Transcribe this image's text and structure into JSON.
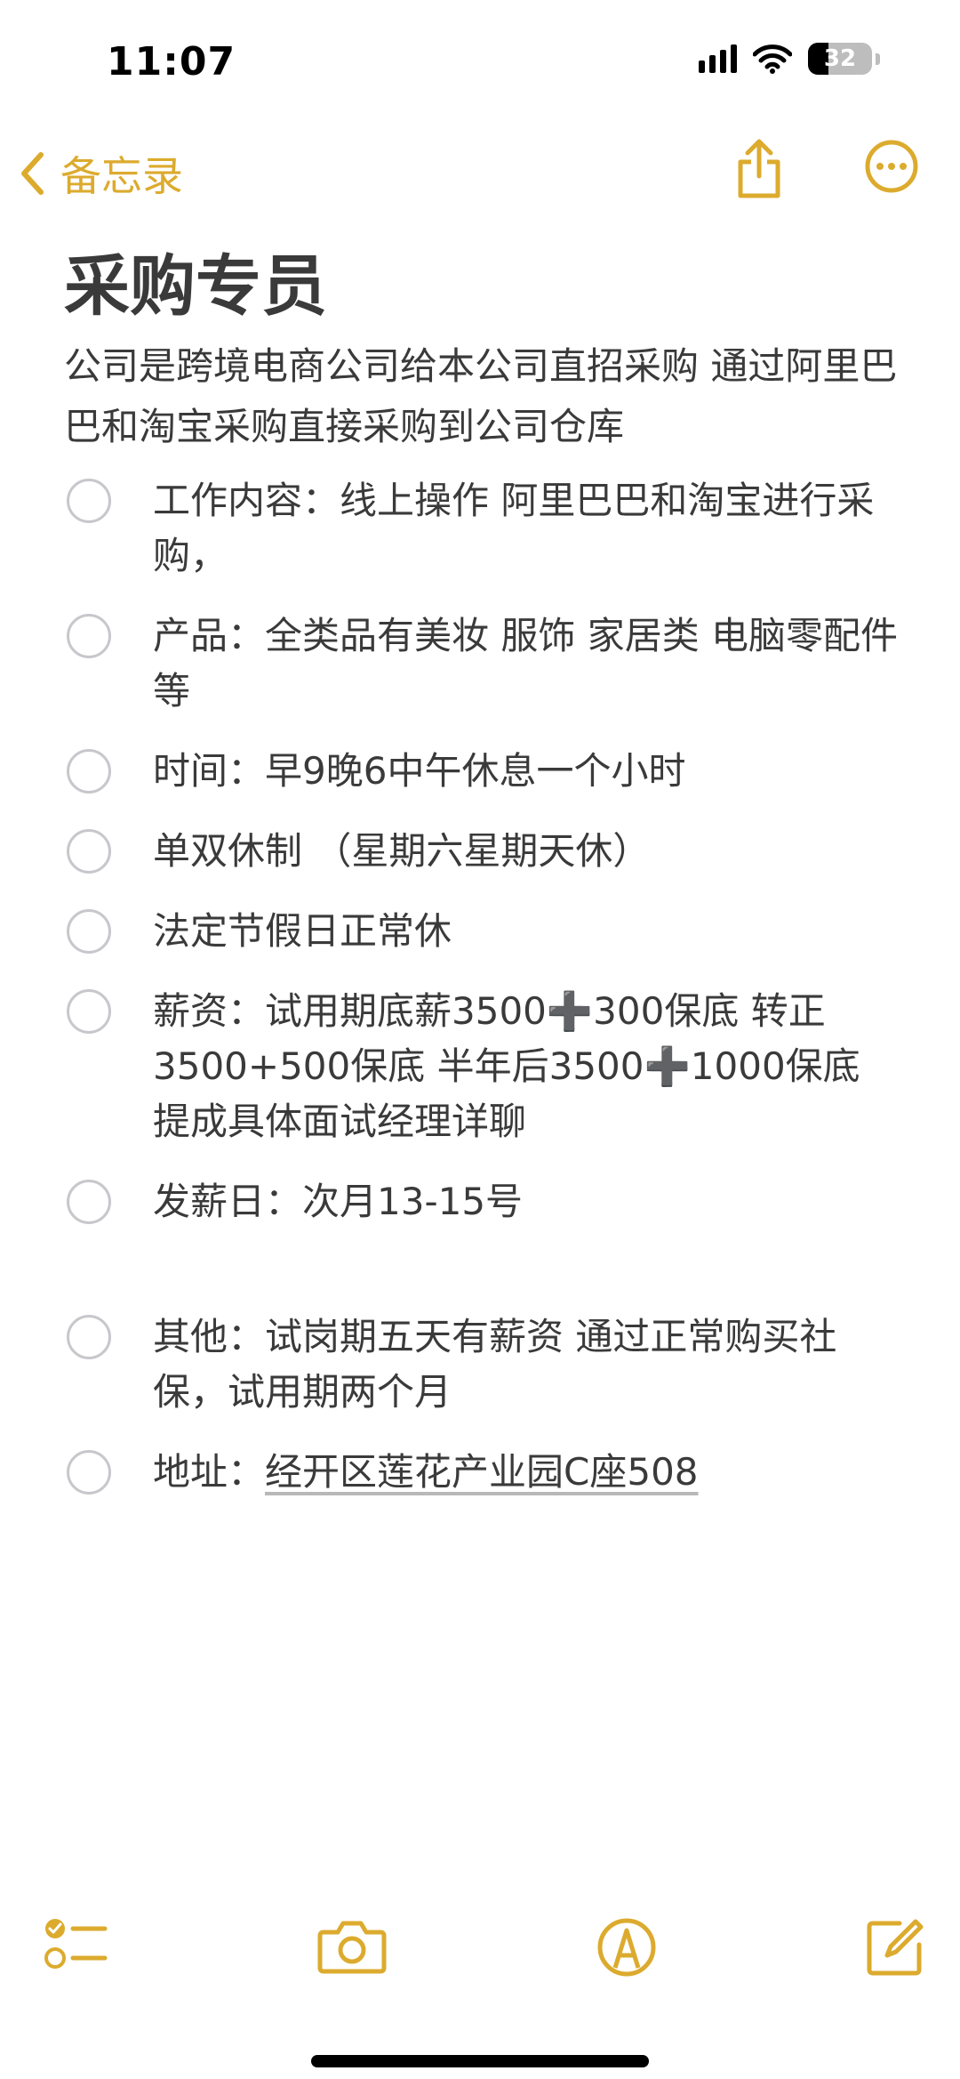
{
  "status_bar": {
    "time": "11:07",
    "battery_level": "32",
    "battery_fraction": 0.32,
    "icons": [
      "cellular-signal-icon",
      "wifi-icon",
      "battery-icon"
    ]
  },
  "nav": {
    "back_label": "备忘录",
    "faded_title": "",
    "icons": [
      "chevron-left-icon",
      "share-icon",
      "more-icon"
    ],
    "accent_color": "#dcab2e"
  },
  "note": {
    "title": "采购专员",
    "intro": "公司是跨境电商公司给本公司直招采购 通过阿里巴巴和淘宝采购直接采购到公司仓库",
    "checklist": [
      {
        "text": "工作内容：线上操作 阿里巴巴和淘宝进行采购，",
        "checked": false
      },
      {
        "text": "产品：全类品有美妆 服饰 家居类 电脑零配件等",
        "checked": false
      },
      {
        "text": "时间：早9晚6中午休息一个小时",
        "checked": false
      },
      {
        "text": "单双休制 （星期六星期天休）",
        "checked": false
      },
      {
        "text": "法定节假日正常休",
        "checked": false
      },
      {
        "text": "薪资：试用期底薪3500➕300保底 转正3500+500保底 半年后3500➕1000保底  提成具体面试经理详聊",
        "checked": false
      },
      {
        "text": "发薪日：次月13-15号",
        "checked": false
      },
      {
        "text": "其他：试岗期五天有薪资 通过正常购买社保，试用期两个月",
        "checked": false
      },
      {
        "address_label": "地址：",
        "address_link": "经开区莲花产业园C座508",
        "checked": false
      }
    ]
  },
  "toolbar": {
    "icons": [
      "checklist-icon",
      "camera-icon",
      "markup-icon",
      "compose-icon"
    ]
  }
}
